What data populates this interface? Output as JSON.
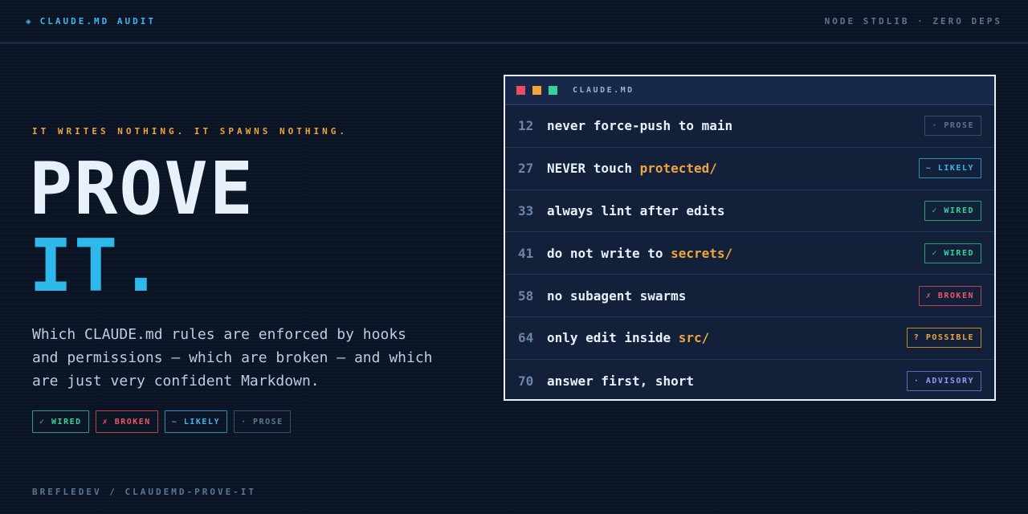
{
  "topbar": {
    "brand_icon": "diamond-icon",
    "brand_glyph": "◈",
    "brand": "CLAUDE.MD AUDIT",
    "tag": "NODE STDLIB · ZERO DEPS"
  },
  "hero": {
    "eyebrow": "IT WRITES NOTHING. IT SPAWNS NOTHING.",
    "line1": "PROVE",
    "line2": "IT.",
    "description": "Which CLAUDE.md rules are enforced by hooks and permissions — which are broken — and which are just very confident Markdown."
  },
  "legend": [
    {
      "label": "✓ WIRED"
    },
    {
      "label": "✗ BROKEN"
    },
    {
      "label": "~ LIKELY"
    },
    {
      "label": "· PROSE"
    }
  ],
  "footer": "BREFLEDEV / CLAUDEMD-PROVE-IT",
  "panel": {
    "title": "CLAUDE.MD",
    "rows": [
      {
        "line": "12",
        "text": "never force-push to main",
        "hl": "",
        "badge": "· PROSE"
      },
      {
        "line": "27",
        "text": "NEVER touch ",
        "hl": "protected/",
        "badge": "~ LIKELY"
      },
      {
        "line": "33",
        "text": "always lint after edits",
        "hl": "",
        "badge": "✓ WIRED"
      },
      {
        "line": "41",
        "text": "do not write to ",
        "hl": "secrets/",
        "badge": "✓ WIRED"
      },
      {
        "line": "58",
        "text": "no subagent swarms",
        "hl": "",
        "badge": "✗ BROKEN"
      },
      {
        "line": "64",
        "text": "only edit inside ",
        "hl": "src/",
        "badge": "? POSSIBLE"
      },
      {
        "line": "70",
        "text": "answer first, short",
        "hl": "",
        "badge": "· ADVISORY"
      }
    ]
  },
  "colors": {
    "background": "#0b1424",
    "accent_blue": "#2fb8ec",
    "accent_orange": "#f0a53c",
    "wired": "#33d39a",
    "broken": "#f0566a",
    "advisory": "#8d9cf5"
  }
}
